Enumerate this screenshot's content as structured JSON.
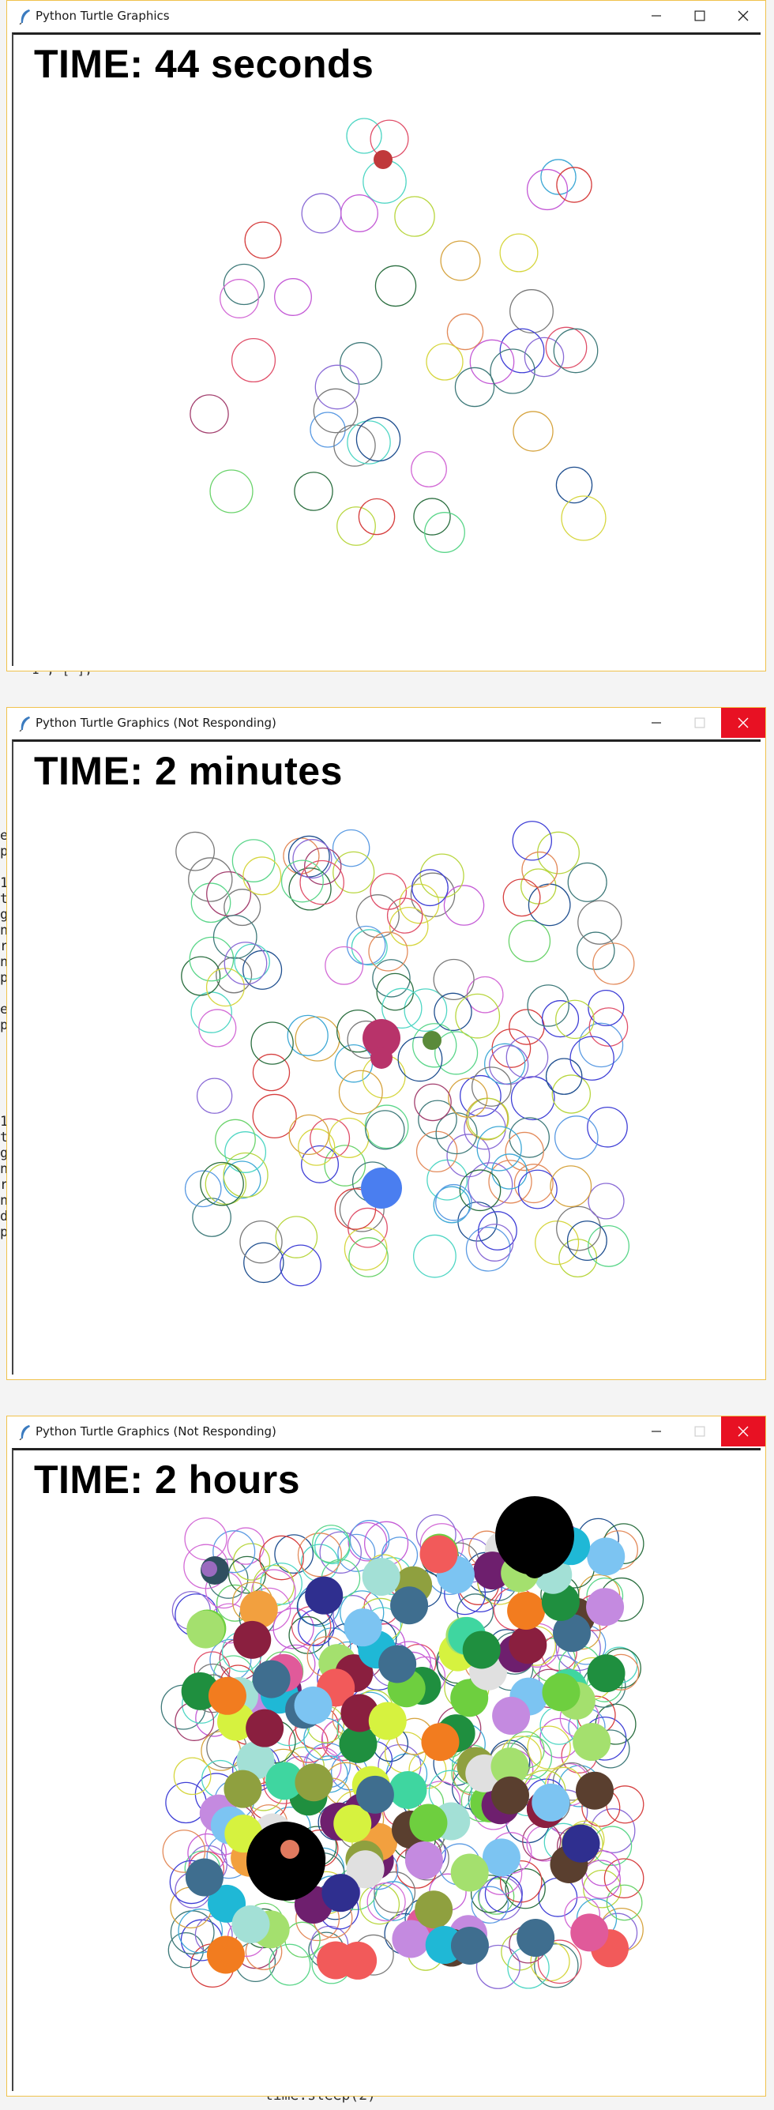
{
  "windows": [
    {
      "title": "Python Turtle Graphics",
      "not_responding": false,
      "time_text": "TIME: 44 seconds"
    },
    {
      "title": "Python Turtle Graphics (Not Responding)",
      "not_responding": true,
      "time_text": "TIME: 2 minutes"
    },
    {
      "title": "Python Turtle Graphics (Not Responding)",
      "not_responding": true,
      "time_text": "TIME: 2 hours"
    }
  ],
  "background_code": {
    "snippet_1": "1\", [ ];",
    "snippet_2": "time.sleep(2)",
    "gutter_1": [
      "e",
      "p",
      "",
      "1",
      "t",
      "g",
      "n",
      "r",
      "n",
      "p",
      "",
      "e",
      "p"
    ],
    "gutter_2": [
      "1",
      "t",
      "g",
      "n",
      "r",
      "n",
      "d",
      "p"
    ]
  },
  "icons": {
    "app_icon": "python-feather-icon",
    "minimize": "minimize-icon",
    "maximize": "maximize-icon",
    "close": "close-icon"
  },
  "colors": {
    "window_border": "#f0c24c",
    "close_hover": "#e81123"
  }
}
